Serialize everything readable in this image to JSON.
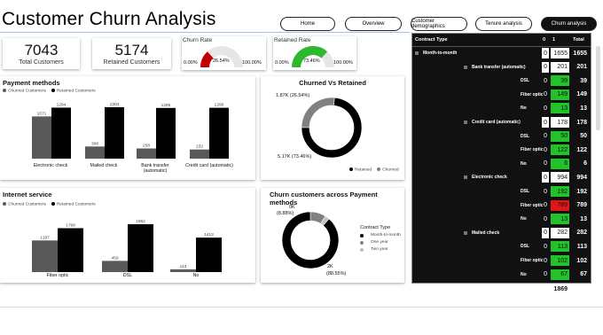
{
  "title": "Customer Churn Analysis",
  "nav": [
    {
      "label": "Home",
      "active": false
    },
    {
      "label": "Overview",
      "active": false
    },
    {
      "label": "Customer demographics",
      "active": false
    },
    {
      "label": "Tenure analysis",
      "active": false
    },
    {
      "label": "Churn analysis",
      "active": true
    }
  ],
  "kpis": {
    "total_customers": {
      "value": "7043",
      "label": "Total Customers"
    },
    "retained_customers": {
      "value": "5174",
      "label": "Retained Customers"
    }
  },
  "gauges": {
    "churn_rate": {
      "title": "Churn Rate",
      "value_label": "26.54%",
      "min_label": "0.00%",
      "max_label": "100.00%",
      "fraction": 0.2654,
      "color": "#c00000"
    },
    "retained_rate": {
      "title": "Retained Rate",
      "value_label": "73.46%",
      "min_label": "0.00%",
      "max_label": "100.00%",
      "fraction": 0.7346,
      "color": "#2eb82e"
    }
  },
  "payment_methods": {
    "title": "Payment methods",
    "legend": [
      "Churned Customers",
      "Retained Customers"
    ],
    "colors": {
      "churned": "#595959",
      "retained": "#000000"
    },
    "categories": [
      "Electronic check",
      "Mailed check",
      "Bank transfer (automatic)",
      "Credit card (automatic)"
    ],
    "churned": [
      1071,
      308,
      258,
      232
    ],
    "retained": [
      1294,
      1304,
      1286,
      1290
    ],
    "churned_labels": [
      "1071",
      "308",
      "258",
      "232"
    ],
    "retained_labels": [
      "1294",
      "1304",
      "1286",
      "1290"
    ]
  },
  "churned_vs_retained": {
    "title": "Churned Vs Retained",
    "churned_label": "1.87K (26.54%)",
    "retained_label": "5.17K (73.46%)",
    "legend": [
      "Retained",
      "Churned"
    ],
    "churned_fraction": 0.2654,
    "colors": {
      "retained": "#000000",
      "churned": "#808080"
    }
  },
  "internet_service": {
    "title": "Internet service",
    "legend": [
      "Churned Customers",
      "Retained Customers"
    ],
    "categories": [
      "Fiber optic",
      "DSL",
      "No"
    ],
    "churned": [
      1297,
      459,
      113
    ],
    "retained": [
      1799,
      1962,
      1413
    ],
    "churned_labels": [
      "1297",
      "459",
      "113"
    ],
    "retained_labels": [
      "1799",
      "1962",
      "1413"
    ]
  },
  "churn_payment_contract": {
    "title": "Churn customers across Payment methods",
    "label_top": "0K",
    "label_top2": "(8.88%)",
    "label_bottom": "2K",
    "label_bottom2": "(88.55%)",
    "legend_title": "Contract Type",
    "legend": [
      "Month-to-month",
      "One year",
      "Two year"
    ],
    "fractions": [
      0.8855,
      0.0888,
      0.0257
    ],
    "colors": [
      "#000000",
      "#808080",
      "#c0c0c0"
    ]
  },
  "pivot": {
    "header": {
      "contract": "Contract Type",
      "c0": "0",
      "c1": "1",
      "total": "Total"
    },
    "rows": [
      {
        "level": 0,
        "label": "Month-to-month",
        "v0": "0",
        "v1": "1655",
        "total": "1655",
        "hl": ""
      },
      {
        "level": 1,
        "label": "Bank transfer (automatic)",
        "v0": "0",
        "v1": "201",
        "total": "201",
        "hl": ""
      },
      {
        "level": 2,
        "label": "DSL",
        "v0": "0",
        "v1": "39",
        "total": "39",
        "hl": "green"
      },
      {
        "level": 2,
        "label": "Fiber optic",
        "v0": "0",
        "v1": "149",
        "total": "149",
        "hl": "green"
      },
      {
        "level": 2,
        "label": "No",
        "v0": "0",
        "v1": "13",
        "total": "13",
        "hl": "green"
      },
      {
        "level": 1,
        "label": "Credit card (automatic)",
        "v0": "0",
        "v1": "178",
        "total": "178",
        "hl": ""
      },
      {
        "level": 2,
        "label": "DSL",
        "v0": "0",
        "v1": "50",
        "total": "50",
        "hl": "green"
      },
      {
        "level": 2,
        "label": "Fiber optic",
        "v0": "0",
        "v1": "122",
        "total": "122",
        "hl": "green"
      },
      {
        "level": 2,
        "label": "No",
        "v0": "0",
        "v1": "6",
        "total": "6",
        "hl": "green"
      },
      {
        "level": 1,
        "label": "Electronic check",
        "v0": "0",
        "v1": "994",
        "total": "994",
        "hl": ""
      },
      {
        "level": 2,
        "label": "DSL",
        "v0": "0",
        "v1": "192",
        "total": "192",
        "hl": "green"
      },
      {
        "level": 2,
        "label": "Fiber optic",
        "v0": "0",
        "v1": "789",
        "total": "789",
        "hl": "red"
      },
      {
        "level": 2,
        "label": "No",
        "v0": "0",
        "v1": "13",
        "total": "13",
        "hl": "green"
      },
      {
        "level": 1,
        "label": "Mailed check",
        "v0": "0",
        "v1": "282",
        "total": "282",
        "hl": ""
      },
      {
        "level": 2,
        "label": "DSL",
        "v0": "0",
        "v1": "113",
        "total": "113",
        "hl": "green"
      },
      {
        "level": 2,
        "label": "Fiber optic",
        "v0": "0",
        "v1": "102",
        "total": "102",
        "hl": "green"
      },
      {
        "level": 2,
        "label": "No",
        "v0": "0",
        "v1": "67",
        "total": "67",
        "hl": "green"
      }
    ],
    "total_row": {
      "label": "Total",
      "v0": "0",
      "v1": "1869",
      "total": "1869"
    },
    "colors": {
      "green": "#22c22a",
      "red": "#e0161b"
    }
  }
}
